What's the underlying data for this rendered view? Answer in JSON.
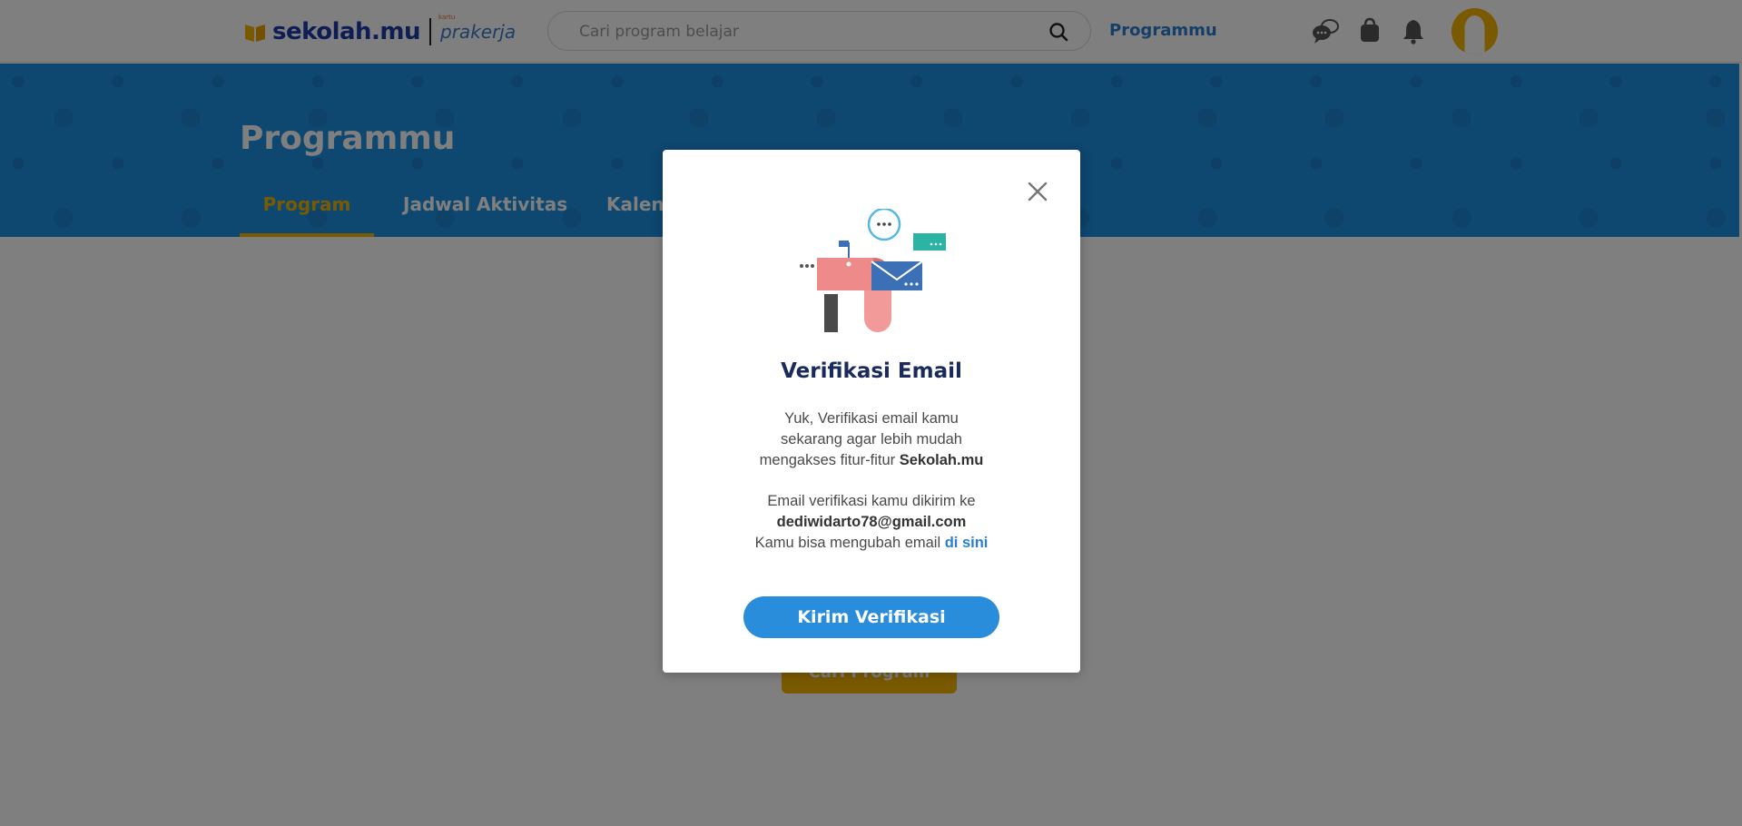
{
  "header": {
    "logo_text": "sekolah.mu",
    "partner_small": "kartu",
    "partner_text": "prakerja",
    "search_placeholder": "Cari program belajar",
    "nav_link": "Programmu",
    "icons": [
      "chat-icon",
      "bag-icon",
      "bell-icon"
    ]
  },
  "banner": {
    "title": "Programmu",
    "tabs": [
      {
        "label": "Program",
        "active": true
      },
      {
        "label": "Jadwal Aktivitas",
        "active": false
      },
      {
        "label": "Kalender",
        "active": false
      }
    ]
  },
  "main": {
    "cari_button": "Cari Program"
  },
  "modal": {
    "title": "Verifikasi Email",
    "line1": "Yuk, Verifikasi email kamu",
    "line2": "sekarang agar lebih mudah",
    "line3_prefix": "mengakses fitur-fitur ",
    "line3_bold": "Sekolah.mu",
    "line4": "Email verifikasi kamu dikirim ke",
    "email": "dediwidarto78@gmail.com",
    "line6_prefix": "Kamu bisa mengubah email ",
    "change_link": "di sini",
    "button": "Kirim Verifikasi"
  },
  "colors": {
    "brand_blue": "#1d3aa8",
    "banner_blue": "#1d8fe0",
    "accent_yellow": "#f4b400",
    "link_blue": "#2a7ed1",
    "button_blue": "#2a8ddb"
  }
}
